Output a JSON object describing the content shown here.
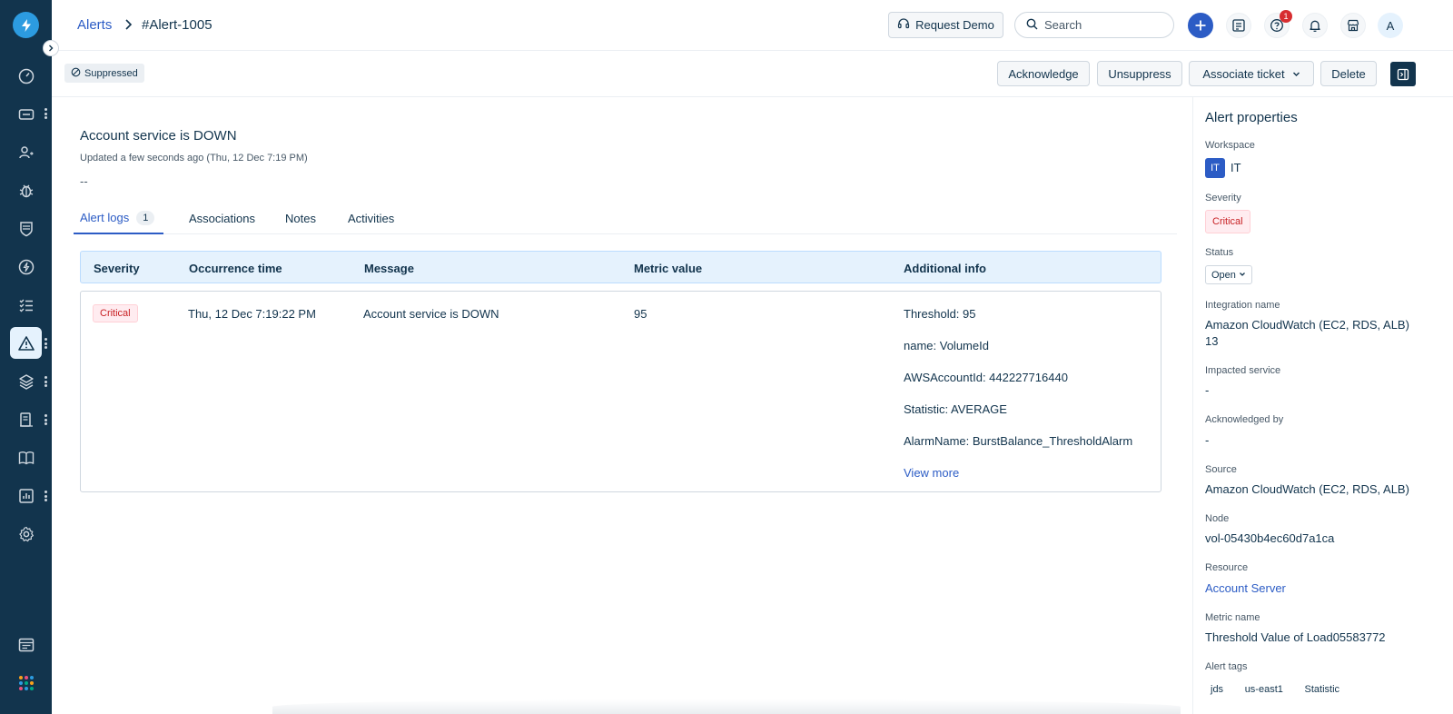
{
  "breadcrumb": {
    "parent": "Alerts",
    "current": "#Alert-1005"
  },
  "header": {
    "request_demo_label": "Request Demo",
    "search_placeholder": "Search",
    "help_badge_count": "1",
    "avatar_initial": "A"
  },
  "actionbar": {
    "status_chip": "Suppressed",
    "acknowledge_label": "Acknowledge",
    "unsuppress_label": "Unsuppress",
    "associate_ticket_label": "Associate ticket",
    "delete_label": "Delete"
  },
  "alert": {
    "title": "Account service is DOWN",
    "updated": "Updated a few seconds ago (Thu, 12 Dec 7:19 PM)",
    "description": "--"
  },
  "tabs": [
    {
      "label": "Alert logs",
      "count": "1"
    },
    {
      "label": "Associations"
    },
    {
      "label": "Notes"
    },
    {
      "label": "Activities"
    }
  ],
  "log_table": {
    "headers": [
      "Severity",
      "Occurrence time",
      "Message",
      "Metric value",
      "Additional info"
    ],
    "rows": [
      {
        "severity": "Critical",
        "occurrence_time": "Thu, 12 Dec 7:19:22 PM",
        "message": "Account service is DOWN",
        "metric_value": "95",
        "additional_info": [
          "Threshold: 95",
          "name: VolumeId",
          "AWSAccountId: 442227716440",
          "Statistic: AVERAGE",
          "AlarmName: BurstBalance_ThresholdAlarm"
        ],
        "view_more": "View more"
      }
    ]
  },
  "properties": {
    "title": "Alert properties",
    "workspace": {
      "label": "Workspace",
      "badge": "IT",
      "value": "IT"
    },
    "severity": {
      "label": "Severity",
      "value": "Critical"
    },
    "status": {
      "label": "Status",
      "value": "Open"
    },
    "integration_name": {
      "label": "Integration name",
      "value": "Amazon CloudWatch (EC2, RDS, ALB) 13"
    },
    "impacted_service": {
      "label": "Impacted service",
      "value": "-"
    },
    "acknowledged_by": {
      "label": "Acknowledged by",
      "value": "-"
    },
    "source": {
      "label": "Source",
      "value": "Amazon CloudWatch (EC2, RDS, ALB)"
    },
    "node": {
      "label": "Node",
      "value": "vol-05430b4ec60d7a1ca"
    },
    "resource": {
      "label": "Resource",
      "value": "Account Server"
    },
    "metric_name": {
      "label": "Metric name",
      "value": "Threshold Value of Load05583772"
    },
    "alert_tags": {
      "label": "Alert tags",
      "values": [
        "jds",
        "us-east1",
        "Statistic"
      ]
    }
  },
  "colors": {
    "rail": "#12344d",
    "accent": "#2c5cc5",
    "critical": "#c82124"
  }
}
